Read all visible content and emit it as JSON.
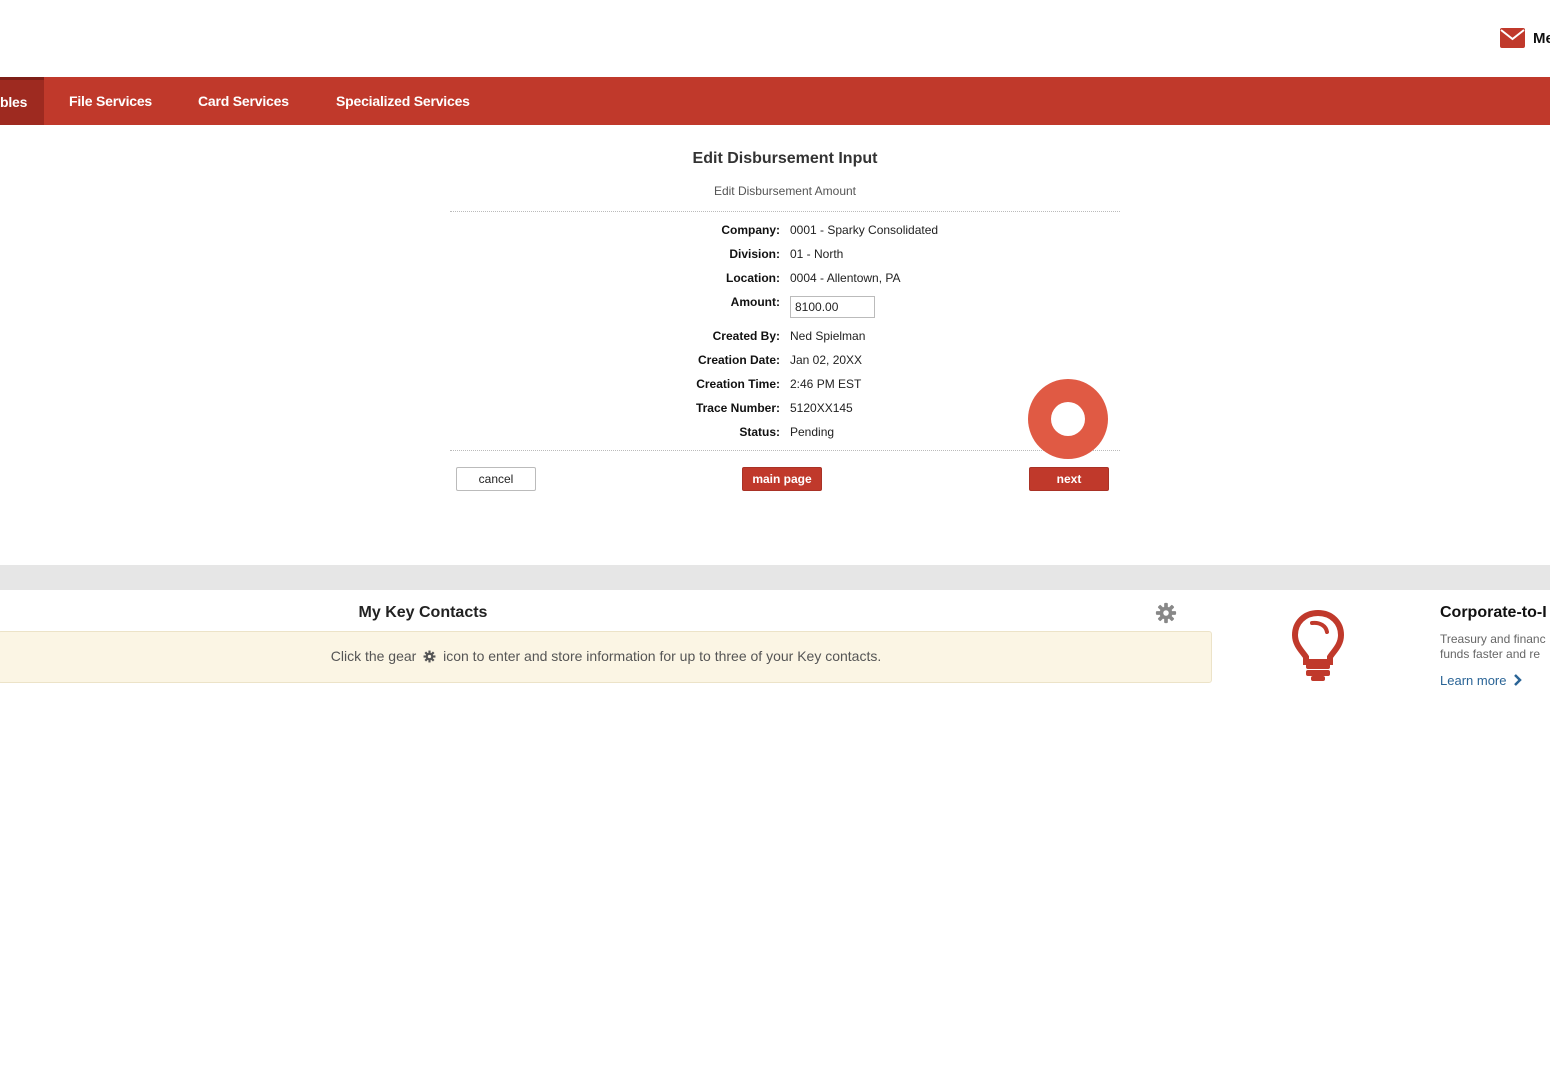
{
  "header": {
    "mail_label": "Me"
  },
  "nav": {
    "items": [
      {
        "label": "bles",
        "active": true
      },
      {
        "label": "File Services",
        "active": false
      },
      {
        "label": "Card Services",
        "active": false
      },
      {
        "label": "Specialized Services",
        "active": false
      }
    ]
  },
  "form": {
    "title": "Edit Disbursement Input",
    "subtitle": "Edit Disbursement Amount",
    "fields": {
      "company": {
        "label": "Company:",
        "value": "0001 - Sparky Consolidated"
      },
      "division": {
        "label": "Division:",
        "value": "01 - North"
      },
      "location": {
        "label": "Location:",
        "value": "0004 - Allentown, PA"
      },
      "amount": {
        "label": "Amount:",
        "value": "8100.00"
      },
      "created_by": {
        "label": "Created By:",
        "value": "Ned Spielman"
      },
      "creation_date": {
        "label": "Creation Date:",
        "value": "Jan 02, 20XX"
      },
      "creation_time": {
        "label": "Creation Time:",
        "value": "2:46 PM EST"
      },
      "trace_number": {
        "label": "Trace Number:",
        "value": "5120XX145"
      },
      "status": {
        "label": "Status:",
        "value": "Pending"
      }
    },
    "buttons": {
      "cancel": "cancel",
      "main_page": "main page",
      "next": "next"
    }
  },
  "contacts": {
    "title": "My Key Contacts",
    "message_before": "Click the gear",
    "message_after": "icon to enter and store information for up to three of your Key contacts."
  },
  "promo": {
    "title": "Corporate-to-I",
    "desc_line1": "Treasury and financ",
    "desc_line2": "funds faster and re",
    "learn_more": "Learn more"
  },
  "colors": {
    "brand_red": "#c0392b",
    "active_nav": "#9e2a20",
    "click_marker": "#e05a44",
    "link_blue": "#2a6496",
    "notice_bg": "#fbf5e4"
  }
}
